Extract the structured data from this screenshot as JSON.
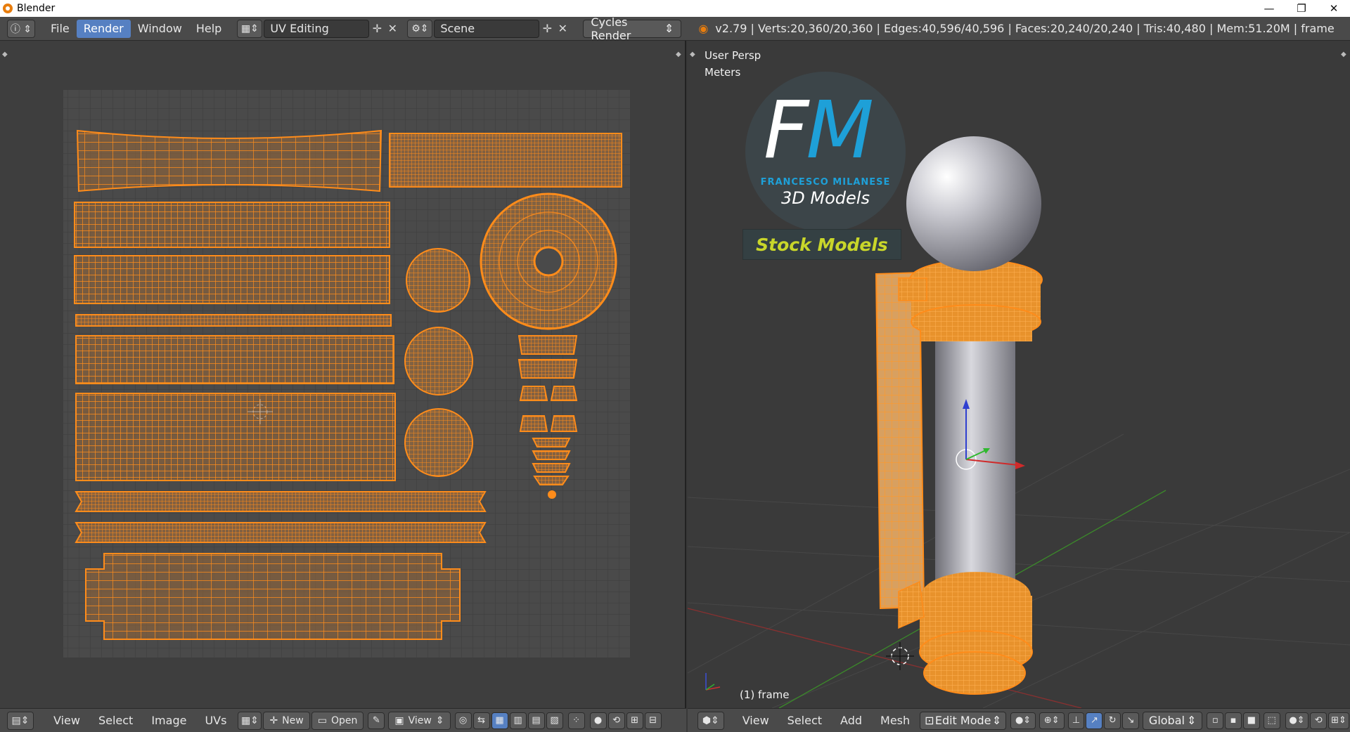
{
  "window": {
    "title": "Blender",
    "minimize": "—",
    "maximize": "❐",
    "close": "✕"
  },
  "info_header": {
    "menus": [
      "File",
      "Render",
      "Window",
      "Help"
    ],
    "active_menu": "Render",
    "screen_layout": "UV Editing",
    "scene": "Scene",
    "render_engine": "Cycles Render",
    "stats": "v2.79 | Verts:20,360/20,360 | Edges:40,596/40,596 | Faces:20,240/20,240 | Tris:40,480 | Mem:51.20M | frame"
  },
  "uv_editor": {
    "menus": [
      "View",
      "Select",
      "Image",
      "UVs"
    ],
    "new_label": "New",
    "open_label": "Open",
    "view_label": "View"
  },
  "viewport": {
    "perspective_label": "User Persp",
    "units_label": "Meters",
    "frame_label": "(1) frame",
    "menus": [
      "View",
      "Select",
      "Add",
      "Mesh"
    ],
    "mode": "Edit Mode",
    "transform_orientation": "Global",
    "watermark": {
      "monogram_f": "F",
      "monogram_m": "M",
      "author": "FRANCESCO MILANESE",
      "subtitle": "3D Models",
      "tagline": "Stock Models"
    }
  },
  "colors": {
    "uv_orange": "#ff8c1a",
    "active_blue": "#5680c2",
    "fm_blue": "#1ea0d8",
    "stock_yellow": "#c9d62a"
  }
}
